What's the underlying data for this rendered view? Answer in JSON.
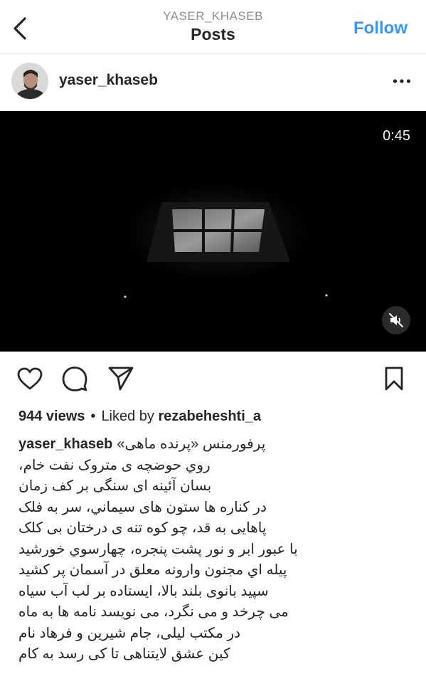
{
  "header": {
    "username": "YASER_KHASEB",
    "title": "Posts",
    "follow_label": "Follow",
    "back_icon": "chevron-left-icon"
  },
  "post": {
    "author": "yaser_khaseb",
    "more_icon": "ellipsis-icon",
    "video": {
      "timer": "0:45",
      "mute_icon": "speaker-muted-icon"
    },
    "actions": {
      "like_icon": "heart-icon",
      "comment_icon": "comment-icon",
      "share_icon": "send-icon",
      "save_icon": "bookmark-icon"
    },
    "stats": {
      "views": "944 views",
      "separator": "•",
      "liked_by_prefix": "Liked by",
      "liked_by_user": "rezabeheshti_a"
    },
    "caption": {
      "user": "yaser_khaseb",
      "first_line_text": "پرفورمنس «پرنده ماهی»",
      "lines": [
        "روي حوضچه ی متروک نفت خام،",
        "بسان آئینه ای سنگی بر کف زمان",
        "در کناره ها ستون های سیماني، سر به فلک",
        "پاهایی به قد، چو کوه تنه ی درختان بی کلک",
        "با عبور ابر و نور پشت پنجره، چهارسوي خورشید",
        "پیله اي مجنون وارونه معلق در آسمان پر کشید",
        "سپید بانوی بلند بالا، ایستاده بر لب آب سیاه",
        "می چرخد و می نگرد، می نویسد نامه ها به ماه",
        "در مکتب لیلی، جام شیرین و فرهاد نام",
        "کین عشق لایتناهی تا کی رسد به کام"
      ]
    }
  }
}
